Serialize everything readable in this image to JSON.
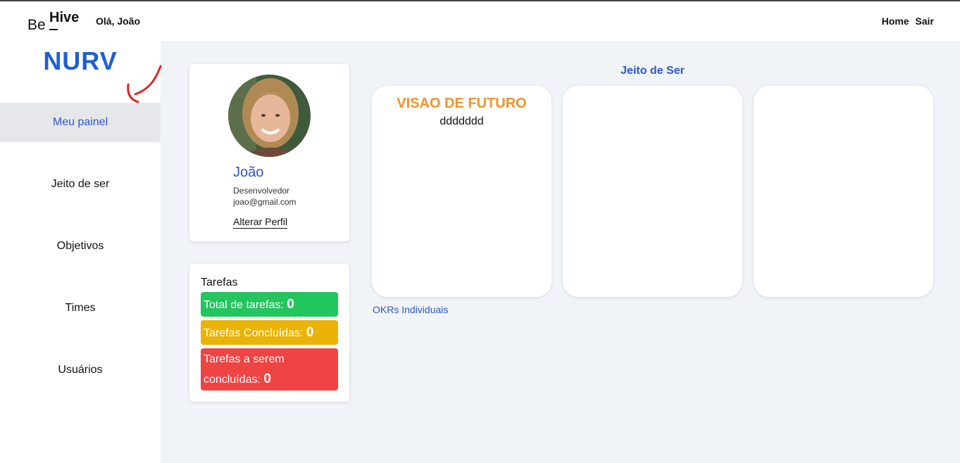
{
  "header": {
    "logo_be": "Be",
    "logo_hive": "Hive",
    "greeting": "Olá, João",
    "links": [
      "Home",
      "Sair"
    ]
  },
  "sidebar": {
    "brand": "NURV",
    "items": [
      {
        "label": "Meu painel",
        "active": true
      },
      {
        "label": "Jeito de ser",
        "active": false
      },
      {
        "label": "Objetivos",
        "active": false
      },
      {
        "label": "Times",
        "active": false
      },
      {
        "label": "Usuários",
        "active": false
      }
    ]
  },
  "profile": {
    "name": "João",
    "role": "Desenvolvedor",
    "email": "joao@gmail.com",
    "edit_label": "Alterar Perfil"
  },
  "tasks": {
    "title": "Tarefas",
    "total_label": "Total de tarefas:",
    "total_value": "0",
    "done_label": "Tarefas Concluídas:",
    "done_value": "0",
    "pending_label_1": "Tarefas a serem",
    "pending_label_2": "concluídas:",
    "pending_value": "0"
  },
  "jeito": {
    "section_title": "Jeito de Ser",
    "cards": [
      {
        "title": "VISAO DE FUTURO",
        "text": "ddddddd"
      },
      {
        "title": "",
        "text": ""
      },
      {
        "title": "",
        "text": ""
      }
    ],
    "okr_link": "OKRs Individuais"
  },
  "colors": {
    "accent": "#2b57c9",
    "brand": "#1f5fd6",
    "vision_title": "#f0932b",
    "task_total": "#22c55e",
    "task_done": "#eab308",
    "task_pending": "#ef4444",
    "annotation": "#d92626"
  }
}
